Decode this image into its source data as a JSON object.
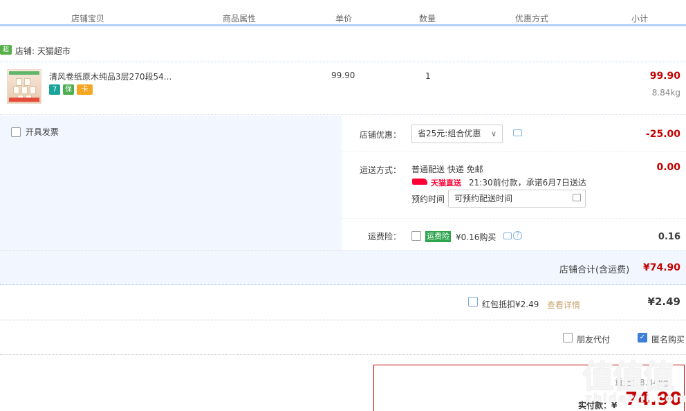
{
  "header": {
    "cols": [
      "店铺宝贝",
      "商品属性",
      "单价",
      "数量",
      "优惠方式",
      "小计"
    ]
  },
  "shop": {
    "badge": "超市",
    "label": "店铺: 天猫超市"
  },
  "item": {
    "title": "清风卷纸原木纯品3层270段54...",
    "unit_price": "99.90",
    "quantity": "1",
    "subtotal": "99.90",
    "weight": "8.84kg",
    "service_icons": [
      "7",
      "保",
      "卡"
    ]
  },
  "invoice": {
    "label": "开具发票"
  },
  "discount": {
    "label": "店铺优惠：",
    "selected": "省25元:组合优惠",
    "amount": "-25.00"
  },
  "shipping": {
    "label": "运送方式：",
    "method": "普通配送 快递 免邮",
    "tmall_delivery": "天猫直送",
    "promise": "21:30前付款，承诺6月7日送达",
    "schedule_label": "预约时间",
    "schedule_value": "可预约配送时间",
    "amount": "0.00"
  },
  "insurance": {
    "label": "运费险：",
    "tag": "运费险",
    "desc": "¥0.16购买",
    "amount": "0.16"
  },
  "shop_total": {
    "label": "店铺合计(含运费)",
    "amount": "¥74.90"
  },
  "red_packet": {
    "label": "红包抵扣¥2.49",
    "link": "查看详情",
    "amount": "¥2.49"
  },
  "options": {
    "friend_pay": "朋友代付",
    "anonymous": "匿名购买"
  },
  "pay": {
    "weight_label": "重量：8.84kg",
    "total_label": "实付款：¥",
    "total": "74.90"
  },
  "watermark": {
    "main": "值值值",
    "sub": "zhidezhi.com"
  },
  "colors": {
    "accent": "#c40000",
    "header_border": "#b2d1ff",
    "panel_bg": "#f2f7ff",
    "tmall_red": "#ff0036",
    "insurance_green": "#2da44e"
  }
}
